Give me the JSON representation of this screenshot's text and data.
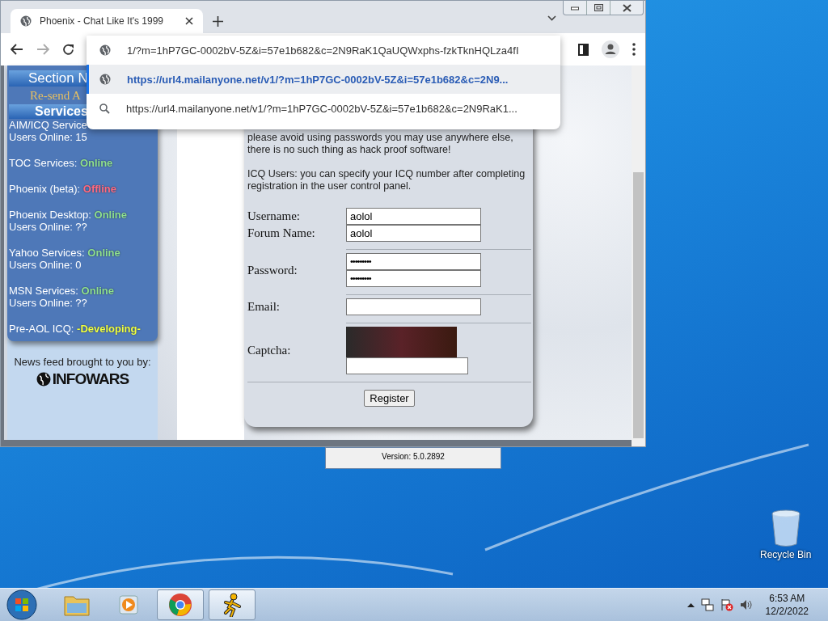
{
  "browser": {
    "tabs": [
      {
        "title": "Phoenix - Chat Like It's 1999",
        "selected": true
      }
    ],
    "omnibox": {
      "value": "1/?m=1hP7GC-0002bV-5Z&i=57e1b682&c=2N9RaK1QaUQWxphs-fzkTknHQLza4fI"
    },
    "suggestions": [
      {
        "kind": "url",
        "text": "https://url4.mailanyone.net/v1/?m=1hP7GC-0002bV-5Z&i=57e1b682&c=2N9...",
        "selected": true
      },
      {
        "kind": "search",
        "text": "https://url4.mailanyone.net/v1/?m=1hP7GC-0002bV-5Z&i=57e1b682&c=2N9RaK1...",
        "selected": false
      }
    ]
  },
  "page": {
    "sidebar": {
      "section_title": "Section N",
      "resend_link": "Re-send A",
      "services_title": "Services",
      "services": [
        {
          "name": "AIM/ICQ Service",
          "users": "Users Online: 15"
        },
        {
          "name": "TOC Services:",
          "status": "Online",
          "color": "#8fe08f"
        },
        {
          "name": "Phoenix (beta):",
          "status": "Offline",
          "color": "#ff6a80"
        },
        {
          "name": "Phoenix Desktop:",
          "status": "Online",
          "color": "#8fe08f",
          "users": "Users Online: ??"
        },
        {
          "name": "Yahoo Services:",
          "status": "Online",
          "color": "#8fe08f",
          "users": "Users Online: 0"
        },
        {
          "name": "MSN Services:",
          "status": "Online",
          "color": "#8fe08f",
          "users": "Users Online: ??"
        },
        {
          "name": "Pre-AOL ICQ:",
          "status": "-Developing-",
          "color": "#f0ff40"
        }
      ],
      "news_caption": "News feed brought to you by:",
      "news_logo": "INFOWARS"
    },
    "form": {
      "notes": [
        "please avoid using passwords you may use anywhere else, there is no such thing as hack proof software!",
        "ICQ Users: you can specify your ICQ number after completing registration in the user control panel."
      ],
      "groups": [
        {
          "rows": [
            {
              "label": "Username:",
              "inputs": [
                {
                  "kind": "text",
                  "value": "aolol"
                }
              ]
            },
            {
              "label": "Forum Name:",
              "inputs": [
                {
                  "kind": "text",
                  "value": "aolol"
                }
              ]
            }
          ]
        },
        {
          "rows": [
            {
              "label": "Password:",
              "inputs": [
                {
                  "kind": "password",
                  "value": "•••••••••"
                },
                {
                  "kind": "password",
                  "value": "•••••••••"
                }
              ]
            }
          ]
        },
        {
          "rows": [
            {
              "label": "Email:",
              "inputs": [
                {
                  "kind": "text"
                }
              ]
            }
          ]
        },
        {
          "rows": [
            {
              "label": "Captcha:",
              "inputs": [
                {
                  "kind": "captcha"
                },
                {
                  "kind": "captcha_answer"
                }
              ]
            }
          ]
        }
      ],
      "submit": "Register"
    }
  },
  "version_panel": {
    "text": "Version: 5.0.2892"
  },
  "desktop_icons": [
    {
      "label": "Recycle Bin"
    }
  ],
  "taskbar": {
    "apps": [
      {
        "kind": "explorer",
        "active": false
      },
      {
        "kind": "media",
        "active": false
      },
      {
        "kind": "chrome",
        "active": true
      },
      {
        "kind": "aim",
        "active": true
      }
    ],
    "clock": {
      "time": "6:53 AM",
      "date": "12/2/2022"
    }
  }
}
